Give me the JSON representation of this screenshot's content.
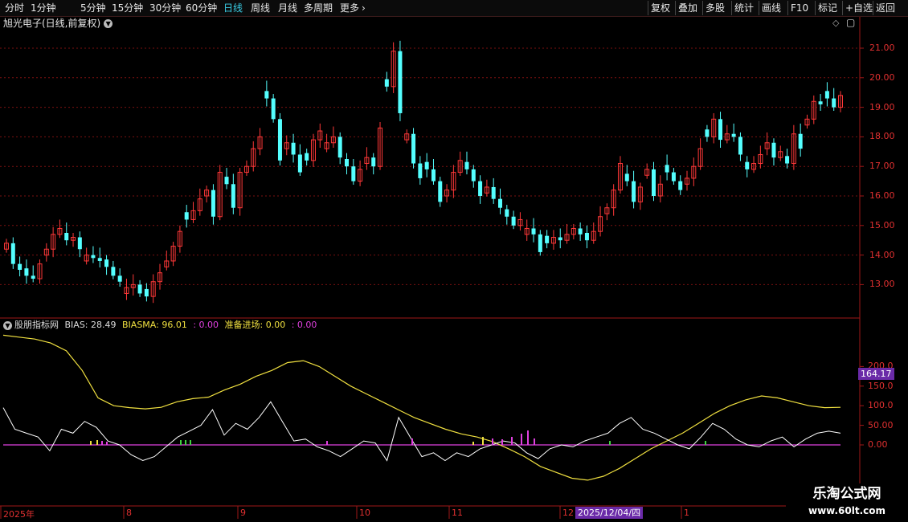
{
  "toolbar": {
    "periods": [
      "分时",
      "1分钟",
      "5分钟",
      "15分钟",
      "30分钟",
      "60分钟",
      "日线",
      "周线",
      "月线",
      "多周期",
      "更多"
    ],
    "active_period": "日线",
    "right_buttons": [
      "复权",
      "叠加",
      "多股",
      "统计",
      "画线",
      "F10",
      "标记",
      "+自选",
      "返回"
    ]
  },
  "main_title": "旭光电子(日线,前复权)",
  "indicator": {
    "name": "股朋指标网",
    "bias_label": "BIAS: 28.49",
    "biasma_label": "BIASMA: 96.01",
    "extra1": ": 0.00",
    "entry_label": "准备进场: 0.00",
    "extra2": ": 0.00"
  },
  "price_axis_labels": [
    "21.00",
    "20.00",
    "19.00",
    "18.00",
    "17.00",
    "16.00",
    "15.00",
    "14.00",
    "13.00"
  ],
  "indicator_axis_labels": [
    "200.0",
    "150.0",
    "100.0",
    "50.00",
    "0.00"
  ],
  "indicator_cursor_value": "164.17",
  "date_axis": {
    "labels": [
      "2025年",
      "8",
      "9",
      "10",
      "11",
      "12",
      "1"
    ],
    "cursor_date": "2025/12/04/四"
  },
  "watermark": {
    "line1": "乐淘公式网",
    "line2": "www.60lt.com"
  },
  "colors": {
    "up": "#ff3838",
    "down": "#54ffff",
    "bias": "#ffffff",
    "biasma": "#f0e040",
    "zero": "#e040e0",
    "grid": "#7a1010"
  }
}
